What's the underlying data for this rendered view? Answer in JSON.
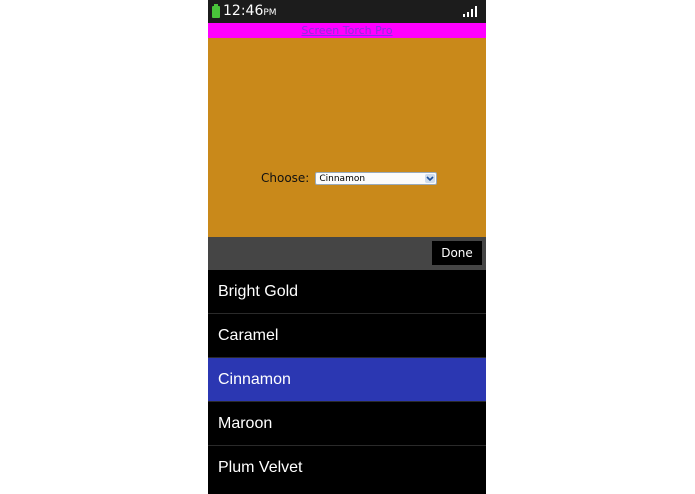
{
  "status": {
    "time": "12:46",
    "ampm": "PM"
  },
  "app": {
    "title": "Screen Torch Pro",
    "background": "#c9891a"
  },
  "form": {
    "label": "Choose:",
    "selected": "Cinnamon"
  },
  "picker": {
    "done_label": "Done",
    "selected_color": "#2b37b2",
    "options": [
      "Bright Gold",
      "Caramel",
      "Cinnamon",
      "Maroon",
      "Plum Velvet"
    ]
  }
}
